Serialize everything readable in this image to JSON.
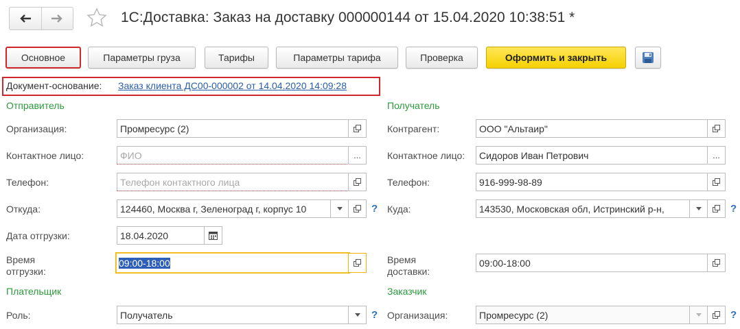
{
  "window": {
    "title": "1С:Доставка: Заказ на доставку 000000144 от 15.04.2020 10:38:51 *"
  },
  "nav": {
    "back_icon": "arrow-left-icon",
    "forward_icon": "arrow-right-icon",
    "favorite_icon": "star-icon"
  },
  "toolbar": {
    "main": "Основное",
    "cargo": "Параметры груза",
    "tariffs": "Тарифы",
    "tariff_params": "Параметры тарифа",
    "check": "Проверка",
    "save_close": "Оформить и закрыть",
    "save_icon": "floppy-disk-icon"
  },
  "basis": {
    "label": "Документ-основание:",
    "link": "Заказ клиента ДС00-000002 от 14.04.2020 14:09:28"
  },
  "sender": {
    "section": "Отправитель",
    "org_label": "Организация:",
    "org_value": "Промресурс (2)",
    "contact_label": "Контактное лицо:",
    "contact_placeholder": "ФИО",
    "phone_label": "Телефон:",
    "phone_placeholder": "Телефон контактного лица",
    "from_label": "Откуда:",
    "from_value": "124460, Москва г, Зеленоград г, корпус 10",
    "ship_date_label": "Дата отгрузки:",
    "ship_date_value": "18.04.2020",
    "ship_time_label_1": "Время",
    "ship_time_label_2": "отгрузки:",
    "ship_time_value": "09:00-18:00"
  },
  "recipient": {
    "section": "Получатель",
    "counterparty_label": "Контрагент:",
    "counterparty_value": "ООО \"Альтаир\"",
    "contact_label": "Контактное лицо:",
    "contact_value": "Сидоров Иван Петрович",
    "phone_label": "Телефон:",
    "phone_value": "916-999-98-89",
    "to_label": "Куда:",
    "to_value": "143530, Московская обл, Истринский р-н,",
    "delivery_time_label_1": "Время",
    "delivery_time_label_2": "доставки:",
    "delivery_time_value": "09:00-18:00"
  },
  "payer": {
    "section": "Плательщик",
    "role_label": "Роль:",
    "role_value": "Получатель"
  },
  "customer": {
    "section": "Заказчик",
    "org_label": "Организация:",
    "org_value": "Промресурс (2)"
  },
  "misc": {
    "ellipsis": "...",
    "help": "?"
  },
  "colors": {
    "section_green": "#2b9a3b",
    "link_blue": "#2a5ea8",
    "primary_yellow": "#f5d100",
    "highlight_red": "#d0262c"
  }
}
